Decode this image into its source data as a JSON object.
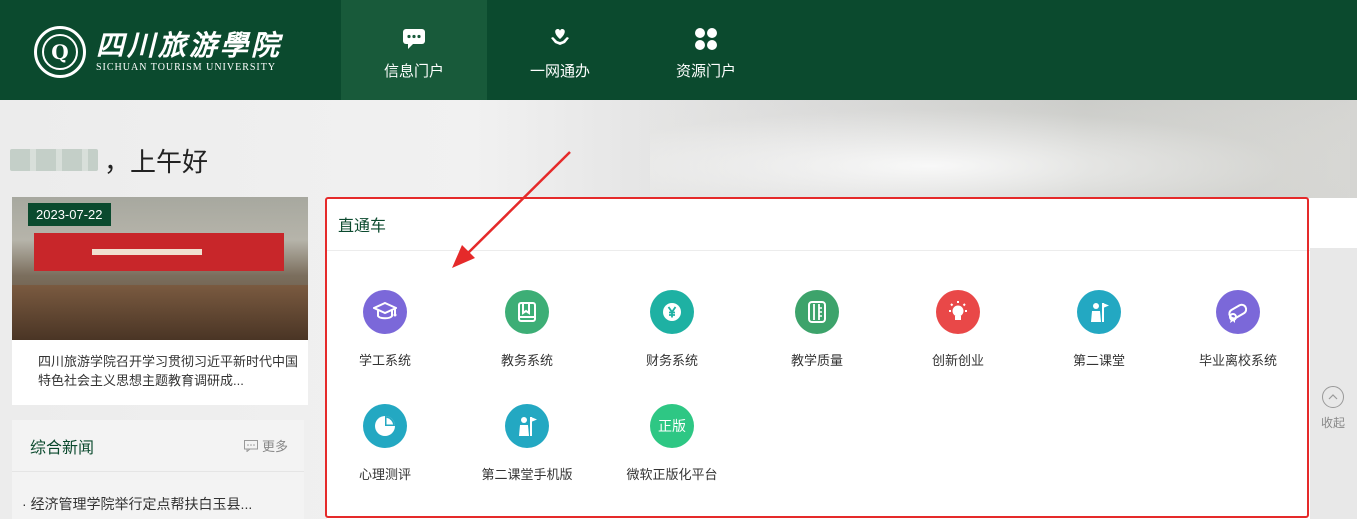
{
  "header": {
    "logo_cn": "四川旅游學院",
    "logo_en": "SICHUAN TOURISM UNIVERSITY",
    "nav": [
      {
        "label": "信息门户",
        "icon": "chat-bubble-icon",
        "active": true
      },
      {
        "label": "一网通办",
        "icon": "heart-hand-icon",
        "active": false
      },
      {
        "label": "资源门户",
        "icon": "clover-icon",
        "active": false
      }
    ]
  },
  "greeting": {
    "text": "，上午好"
  },
  "news_card": {
    "date": "2023-07-22",
    "title": "四川旅游学院召开学习贯彻习近平新时代中国特色社会主义思想主题教育调研成..."
  },
  "general_news": {
    "title": "综合新闻",
    "more": "更多",
    "items": [
      "经济管理学院举行定点帮扶白玉县..."
    ]
  },
  "through_train": {
    "title": "直通车",
    "apps": [
      {
        "label": "学工系统",
        "color": "#7b68d9",
        "icon": "graduation-cap-icon"
      },
      {
        "label": "教务系统",
        "color": "#3dae76",
        "icon": "book-icon"
      },
      {
        "label": "财务系统",
        "color": "#1eb1a3",
        "icon": "yen-icon"
      },
      {
        "label": "教学质量",
        "color": "#3da36b",
        "icon": "ruler-icon"
      },
      {
        "label": "创新创业",
        "color": "#e94848",
        "icon": "lightbulb-icon"
      },
      {
        "label": "第二课堂",
        "color": "#23a8c2",
        "icon": "person-flag-icon"
      },
      {
        "label": "毕业离校系统",
        "color": "#7b68d9",
        "icon": "diploma-icon"
      },
      {
        "label": "心理测评",
        "color": "#23a8c2",
        "icon": "pie-chart-icon"
      },
      {
        "label": "第二课堂手机版",
        "color": "#23a8c2",
        "icon": "person-flag-icon"
      },
      {
        "label": "微软正版化平台",
        "color": "#2ec784",
        "icon_text": "正版"
      }
    ],
    "collapse_label": "收起"
  }
}
